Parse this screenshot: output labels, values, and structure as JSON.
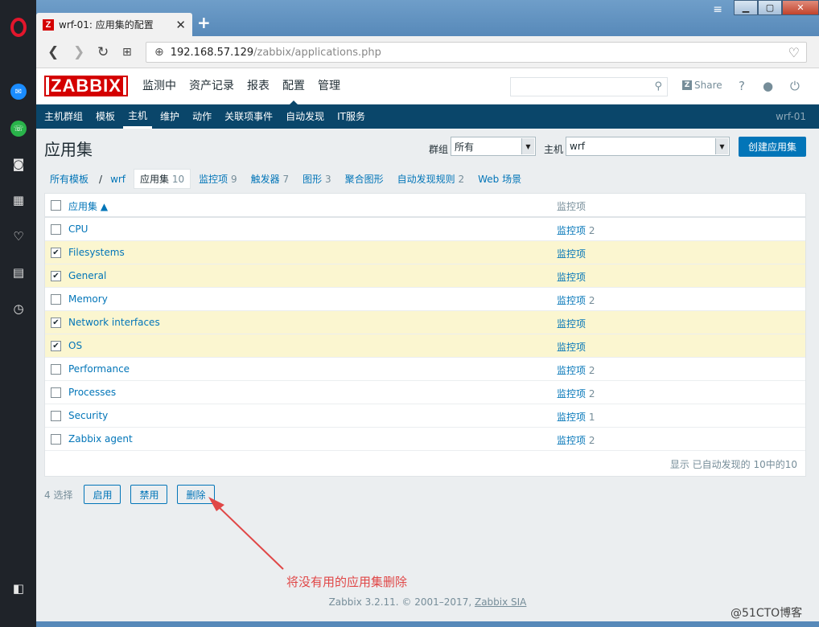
{
  "browser": {
    "tab_title": "wrf-01: 应用集的配置",
    "url_host": "192.168.57.129",
    "url_path": "/zabbix/applications.php"
  },
  "topnav": {
    "logo": "ZABBIX",
    "menu": [
      "监测中",
      "资产记录",
      "报表",
      "配置",
      "管理"
    ],
    "share": "Share",
    "help": "?"
  },
  "subnav": {
    "items": [
      "主机群组",
      "模板",
      "主机",
      "维护",
      "动作",
      "关联项事件",
      "自动发现",
      "IT服务"
    ],
    "host": "wrf-01"
  },
  "header": {
    "title": "应用集",
    "group_label": "群组",
    "group_value": "所有",
    "host_label": "主机",
    "host_value": "wrf",
    "create_button": "创建应用集"
  },
  "filter_tabs": [
    {
      "label": "所有模板",
      "count": ""
    },
    {
      "label": "wrf",
      "count": ""
    },
    {
      "label": "应用集",
      "count": "10"
    },
    {
      "label": "监控项",
      "count": "9"
    },
    {
      "label": "触发器",
      "count": "7"
    },
    {
      "label": "图形",
      "count": "3"
    },
    {
      "label": "聚合图形",
      "count": ""
    },
    {
      "label": "自动发现规则",
      "count": "2"
    },
    {
      "label": "Web 场景",
      "count": ""
    }
  ],
  "table": {
    "col_name": "应用集 ▲",
    "col_items": "监控项",
    "rows": [
      {
        "name": "CPU",
        "items": "监控项",
        "count": "2",
        "checked": false
      },
      {
        "name": "Filesystems",
        "items": "监控项",
        "count": "",
        "checked": true
      },
      {
        "name": "General",
        "items": "监控项",
        "count": "",
        "checked": true
      },
      {
        "name": "Memory",
        "items": "监控项",
        "count": "2",
        "checked": false
      },
      {
        "name": "Network interfaces",
        "items": "监控项",
        "count": "",
        "checked": true
      },
      {
        "name": "OS",
        "items": "监控项",
        "count": "",
        "checked": true
      },
      {
        "name": "Performance",
        "items": "监控项",
        "count": "2",
        "checked": false
      },
      {
        "name": "Processes",
        "items": "监控项",
        "count": "2",
        "checked": false
      },
      {
        "name": "Security",
        "items": "监控项",
        "count": "1",
        "checked": false
      },
      {
        "name": "Zabbix agent",
        "items": "监控项",
        "count": "2",
        "checked": false
      }
    ],
    "footer": "显示 已自动发现的 10中的10"
  },
  "actions": {
    "selected_count": "4 选择",
    "enable": "启用",
    "disable": "禁用",
    "delete": "删除"
  },
  "annotation": "将没有用的应用集删除",
  "footer": {
    "text": "Zabbix 3.2.11. © 2001–2017, ",
    "link": "Zabbix SIA"
  },
  "watermark": "@51CTO博客"
}
